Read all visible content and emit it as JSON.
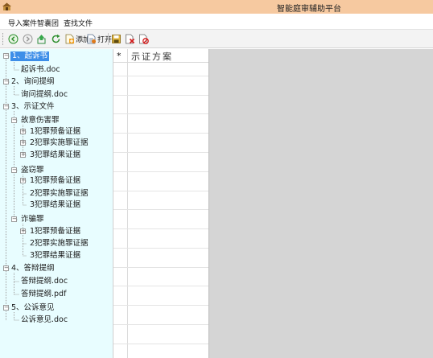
{
  "window": {
    "title": "智能庭审辅助平台"
  },
  "menu": [
    "导入案件",
    "智囊团",
    "查找文件"
  ],
  "toolbar": {
    "add_label": "添加",
    "open_label": "打开"
  },
  "tree": {
    "n1": "1、起诉书",
    "n1a": "起诉书.doc",
    "n2": "2、询问提纲",
    "n2a": "询问提纲.doc",
    "n3": "3、示证文件",
    "n3a": "故意伤害罪",
    "n3a1": "1犯罪预备证据",
    "n3a2": "2犯罪实施罪证据",
    "n3a3": "3犯罪结果证据",
    "n3b": "盗窃罪",
    "n3b1": "1犯罪预备证据",
    "n3b2": "2犯罪实施罪证据",
    "n3b3": "3犯罪结果证据",
    "n3c": "诈骗罪",
    "n3c1": "1犯罪预备证据",
    "n3c2": "2犯罪实施罪证据",
    "n3c3": "3犯罪结果证据",
    "n4": "4、答辩提纲",
    "n4a": "答辩提纲.doc",
    "n4b": "答辩提纲.pdf",
    "n5": "5、公诉意见",
    "n5a": "公诉意见.doc"
  },
  "grid": {
    "new_row_marker": "*",
    "column_header": "示证方案"
  },
  "colors": {
    "tree_bg": "#e8fdff",
    "selection": "#3d8ee8",
    "titlebar": "#f6c9a0",
    "empty_area": "#d5d5d5"
  },
  "icons": [
    "app-icon",
    "back-icon",
    "forward-icon",
    "upload-icon",
    "refresh-icon",
    "add-file-icon",
    "open-file-icon",
    "save-icon",
    "delete-icon",
    "cancel-icon"
  ]
}
